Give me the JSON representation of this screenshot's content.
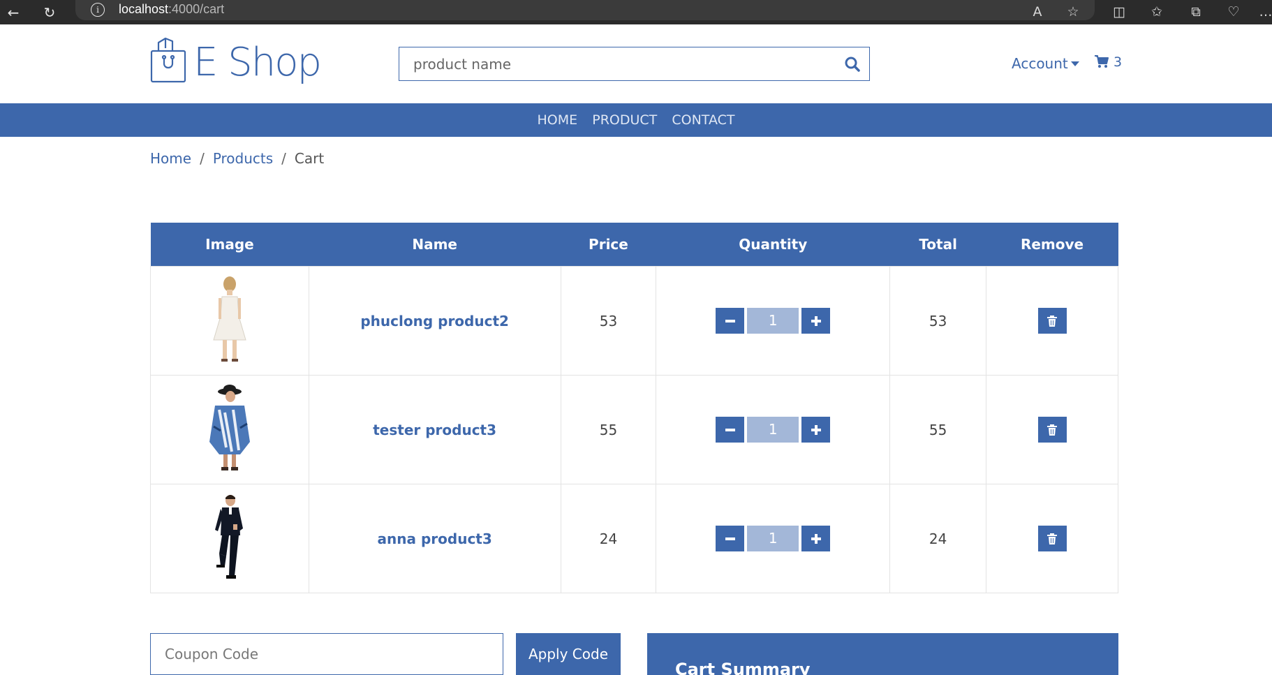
{
  "browser": {
    "url_host": "localhost",
    "url_rest": ":4000/cart"
  },
  "header": {
    "brand": "E Shop",
    "search_placeholder": "product name",
    "account_label": "Account",
    "cart_count": "3"
  },
  "nav": {
    "items": [
      "HOME",
      "PRODUCT",
      "CONTACT"
    ]
  },
  "breadcrumb": {
    "items": [
      "Home",
      "Products",
      "Cart"
    ]
  },
  "table": {
    "headers": [
      "Image",
      "Name",
      "Price",
      "Quantity",
      "Total",
      "Remove"
    ],
    "rows": [
      {
        "name": "phuclong product2",
        "price": "53",
        "qty": "1",
        "total": "53"
      },
      {
        "name": "tester product3",
        "price": "55",
        "qty": "1",
        "total": "55"
      },
      {
        "name": "anna product3",
        "price": "24",
        "qty": "1",
        "total": "24"
      }
    ]
  },
  "coupon": {
    "placeholder": "Coupon Code",
    "apply_label": "Apply Code"
  },
  "summary": {
    "title": "Cart Summary"
  },
  "colors": {
    "brand": "#3d67ab",
    "qty_field": "#a3b7d8"
  }
}
